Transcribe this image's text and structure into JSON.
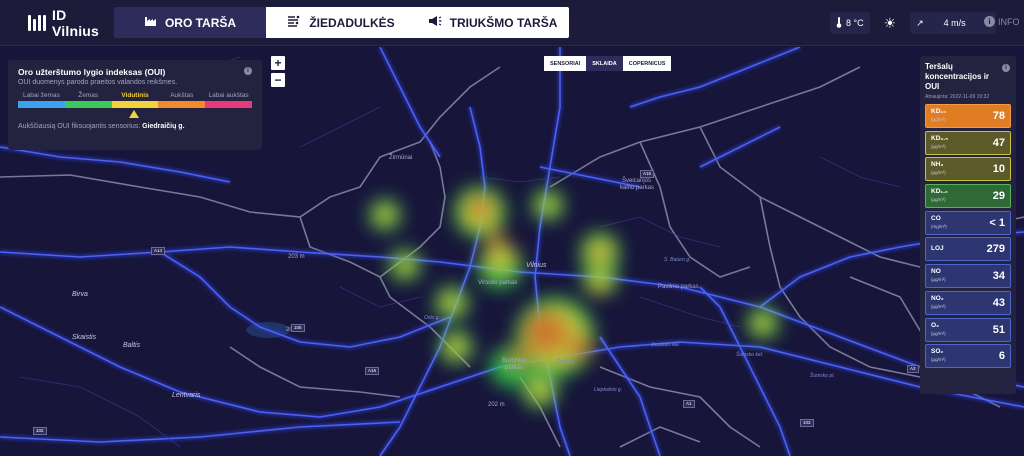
{
  "app": {
    "logo_text": "ID Vilnius"
  },
  "tabs": [
    {
      "label": "ORO TARŠA",
      "icon": "factory-icon",
      "active": true
    },
    {
      "label": "ŽIEDADULKĖS",
      "icon": "pollen-icon",
      "active": false
    },
    {
      "label": "TRIUKŠMO TARŠA",
      "icon": "megaphone-icon",
      "active": false
    }
  ],
  "weather": {
    "temperature": "8 °C",
    "condition_icon": "sun-icon",
    "wind": "4 m/s"
  },
  "info_label": "INFO",
  "oui_panel": {
    "title": "Oro užterštumo lygio indeksas (OUI)",
    "subtitle": "OUI duomenys parodo praeitos valandos reikšmes.",
    "levels": [
      "Labai žemas",
      "Žemas",
      "Vidutinis",
      "Aukštas",
      "Labai aukštas"
    ],
    "selected_level": "Vidutinis",
    "level_colors": [
      "#3aa0f0",
      "#3cc85a",
      "#f2d23a",
      "#f08a2a",
      "#e83a7a"
    ],
    "highest_label": "Aukščiausią OUI fiksuojantis sensorius:",
    "highest_sensor": "Giedraičių g."
  },
  "zoom": {
    "in": "+",
    "out": "−"
  },
  "layer_switch": [
    {
      "label": "SENSORIAI",
      "active": false
    },
    {
      "label": "SKLAIDA",
      "active": true
    },
    {
      "label": "COPERNICUS",
      "active": false
    }
  ],
  "pollutants_panel": {
    "title": "Teršalų koncentracijos ir OUI",
    "updated": "Atnaujinta: 2022-11-09 19:32",
    "items": [
      {
        "name": "KD₁₀",
        "unit": "(µg/m³)",
        "value": "78",
        "style": "orange"
      },
      {
        "name": "KD₂.₅",
        "unit": "(µg/m³)",
        "value": "47",
        "style": "olive"
      },
      {
        "name": "NH₃",
        "unit": "(µg/m³)",
        "value": "10",
        "style": "olive"
      },
      {
        "name": "KD₁.₀",
        "unit": "(µg/m³)",
        "value": "29",
        "style": "green"
      },
      {
        "name": "CO",
        "unit": "(mg/m³)",
        "value": "< 1",
        "style": "blue"
      },
      {
        "name": "LOJ",
        "unit": "",
        "value": "279",
        "style": "blue"
      },
      {
        "name": "NO",
        "unit": "(µg/m³)",
        "value": "34",
        "style": "blue"
      },
      {
        "name": "NO₂",
        "unit": "(µg/m³)",
        "value": "43",
        "style": "blue"
      },
      {
        "name": "O₃",
        "unit": "(µg/m³)",
        "value": "51",
        "style": "blue"
      },
      {
        "name": "SO₂",
        "unit": "(µg/m³)",
        "value": "6",
        "style": "blue"
      }
    ]
  },
  "map_labels": {
    "city": "Vilnius",
    "zirmunai": "Žirmūnai",
    "sveicarijos": "Šveicarijos",
    "sveicarijos2": "kalno parkas",
    "pavilnio": "Pavilnio parkas",
    "birvai": "Birva",
    "skaistis": "Skaistis",
    "baltis": "Baltis",
    "lentvaris": "Lentvaris",
    "virsuliskes": "Virsulio parkas",
    "burbiskio": "Burbiškio",
    "burbiskio2": "parkas",
    "elev1": "203 m",
    "elev2": "200 m",
    "elev3": "202 m",
    "juodasis": "Juodasis kel.",
    "sumsko1": "Šumsko kel.",
    "sumsko2": "Šumsko pl.",
    "zirnio": "Žirnio g.",
    "liepkalnio": "Liepkalnio g.",
    "baturo": "S. Baturo g.",
    "oslo": "Oslo g.",
    "shields": [
      "A14",
      "105",
      "A16",
      "102",
      "A1",
      "A16",
      "103",
      "A3"
    ]
  }
}
